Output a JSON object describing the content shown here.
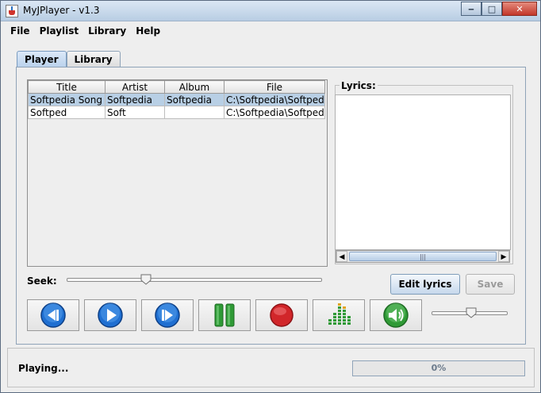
{
  "window": {
    "title": "MyJPlayer - v1.3",
    "icon": "java-cup-icon"
  },
  "menu": [
    "File",
    "Playlist",
    "Library",
    "Help"
  ],
  "tabs": [
    {
      "label": "Player",
      "active": true
    },
    {
      "label": "Library",
      "active": false
    }
  ],
  "table": {
    "columns": [
      "Title",
      "Artist",
      "Album",
      "File"
    ],
    "rows": [
      [
        "Softpedia Song",
        "Softpedia",
        "Softpedia",
        "C:\\Softpedia\\Softped..."
      ],
      [
        "Softped",
        "Soft",
        "",
        "C:\\Softpedia\\Softped..."
      ]
    ],
    "selected_row": 0
  },
  "lyrics": {
    "label": "Lyrics:",
    "text": ""
  },
  "seek": {
    "label": "Seek:",
    "position": 0.31
  },
  "buttons": {
    "edit_lyrics": "Edit lyrics",
    "save": "Save"
  },
  "controls": [
    {
      "name": "previous-button",
      "icon": "previous-icon"
    },
    {
      "name": "play-button",
      "icon": "play-icon"
    },
    {
      "name": "next-button",
      "icon": "next-icon"
    },
    {
      "name": "pause-button",
      "icon": "pause-icon"
    },
    {
      "name": "stop-button",
      "icon": "record-stop-icon"
    },
    {
      "name": "equalizer-button",
      "icon": "equalizer-icon"
    },
    {
      "name": "mute-button",
      "icon": "speaker-icon"
    }
  ],
  "volume": {
    "position": 0.52
  },
  "status": {
    "text": "Playing...",
    "progress_label": "0%",
    "progress": 0.0
  },
  "colors": {
    "selection": "#b8cfe5",
    "accent_blue": "#1f6fd1",
    "accent_green": "#2f9a36",
    "accent_red": "#d1262a"
  }
}
